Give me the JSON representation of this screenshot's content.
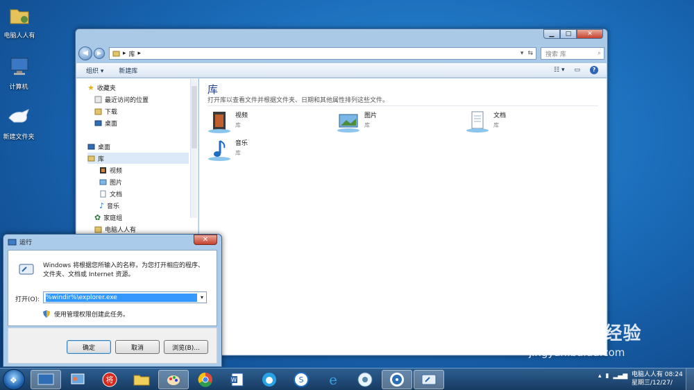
{
  "desktop": {
    "icons": [
      {
        "label": "电脑人人有",
        "icon": "user-folder-icon"
      },
      {
        "label": "计算机",
        "icon": "computer-icon"
      },
      {
        "label": "新建文件夹",
        "icon": "folder-icon"
      }
    ]
  },
  "explorer": {
    "address_path": "库",
    "search_placeholder": "搜索 库",
    "toolbar": {
      "organize": "组织 ▾",
      "new_library": "新建库"
    },
    "nav": {
      "favorites": "收藏夹",
      "recent": "最近访问的位置",
      "downloads": "下载",
      "desktop_fav": "桌面",
      "desktop_root": "桌面",
      "libraries": "库",
      "videos": "视频",
      "pictures": "图片",
      "documents": "文档",
      "music": "音乐",
      "homegroup": "家庭组",
      "user": "电脑人人有"
    },
    "content": {
      "title": "库",
      "description": "打开库以查看文件并根据文件夹、日期和其他属性排列这些文件。",
      "items": [
        {
          "name": "视频",
          "type": "库"
        },
        {
          "name": "图片",
          "type": "库"
        },
        {
          "name": "文档",
          "type": "库"
        },
        {
          "name": "音乐",
          "type": "库"
        }
      ]
    }
  },
  "run_dialog": {
    "title": "运行",
    "description": "Windows 将根据您所输入的名称，为您打开相应的程序、文件夹、文档或 Internet 资源。",
    "open_label": "打开(O):",
    "command_value": "%windir%\\explorer.exe",
    "admin_note": "使用管理权限创建此任务。",
    "ok": "确定",
    "cancel": "取消",
    "browse": "浏览(B)..."
  },
  "taskbar": {
    "clock_line1": "电脑人人有 08:24",
    "clock_line2": "星期三/12/27/"
  },
  "watermark": {
    "brand": "Bai du 经验",
    "url": "jingyan.baidu.com"
  }
}
